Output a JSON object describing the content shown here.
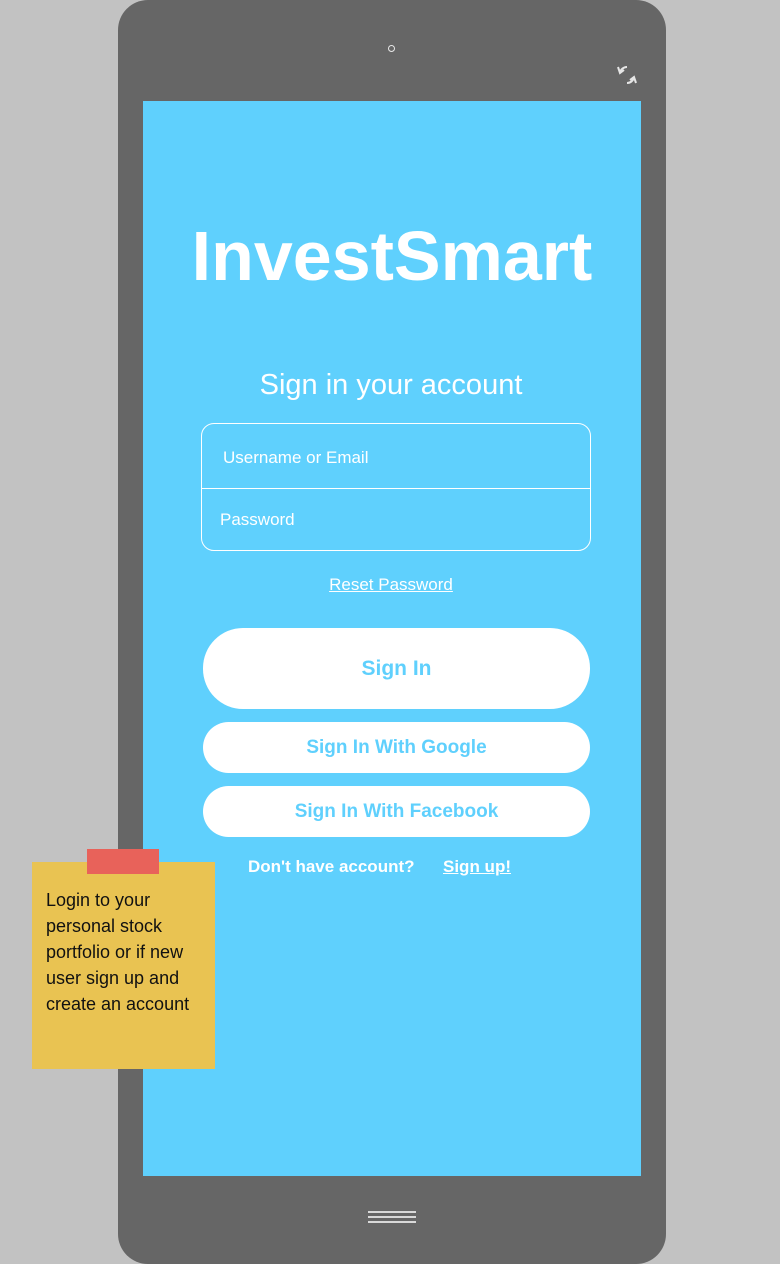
{
  "colors": {
    "background": "#c2c2c2",
    "device": "#666666",
    "screen": "#5fd0fd",
    "button_bg": "#ffffff",
    "button_text": "#5fd0fd",
    "note": "#e9c352",
    "note_tape": "#e8625a"
  },
  "device": {
    "camera_icon": "camera-dot",
    "rotate_icon": "rotate-icon",
    "home_icon": "menu-lines-icon"
  },
  "app": {
    "title": "InvestSmart",
    "subtitle": "Sign in your account"
  },
  "form": {
    "username_placeholder": "Username or Email",
    "username_value": "",
    "password_placeholder": "Password",
    "password_value": ""
  },
  "links": {
    "reset_password": "Reset Password",
    "no_account": "Don't have account?",
    "sign_up": "Sign up!"
  },
  "buttons": {
    "sign_in": "Sign In",
    "sign_in_google": "Sign In With Google",
    "sign_in_facebook": "Sign In With Facebook"
  },
  "note": {
    "text": "Login to your personal stock portfolio or if new user sign up and create an account"
  }
}
